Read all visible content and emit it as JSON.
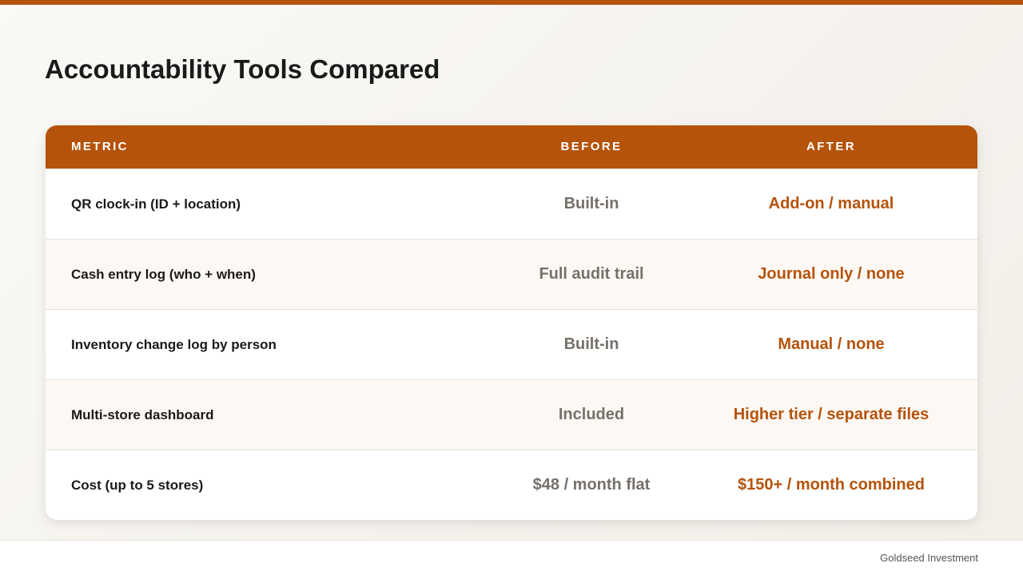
{
  "title": "Accountability Tools Compared",
  "table": {
    "headers": {
      "metric": "METRIC",
      "before": "BEFORE",
      "after": "AFTER"
    },
    "rows": [
      {
        "metric": "QR clock-in (ID + location)",
        "before": "Built-in",
        "after": "Add-on / manual"
      },
      {
        "metric": "Cash entry log (who + when)",
        "before": "Full audit trail",
        "after": "Journal only / none"
      },
      {
        "metric": "Inventory change log by person",
        "before": "Built-in",
        "after": "Manual / none"
      },
      {
        "metric": "Multi-store dashboard",
        "before": "Included",
        "after": "Higher tier / separate files"
      },
      {
        "metric": "Cost (up to 5 stores)",
        "before": "$48 / month flat",
        "after": "$150+ / month combined"
      }
    ]
  },
  "footer": {
    "brand": "Goldseed Investment"
  },
  "colors": {
    "accent": "#b5530b",
    "before_text": "#76706a",
    "alt_row": "#fdf8f4"
  }
}
